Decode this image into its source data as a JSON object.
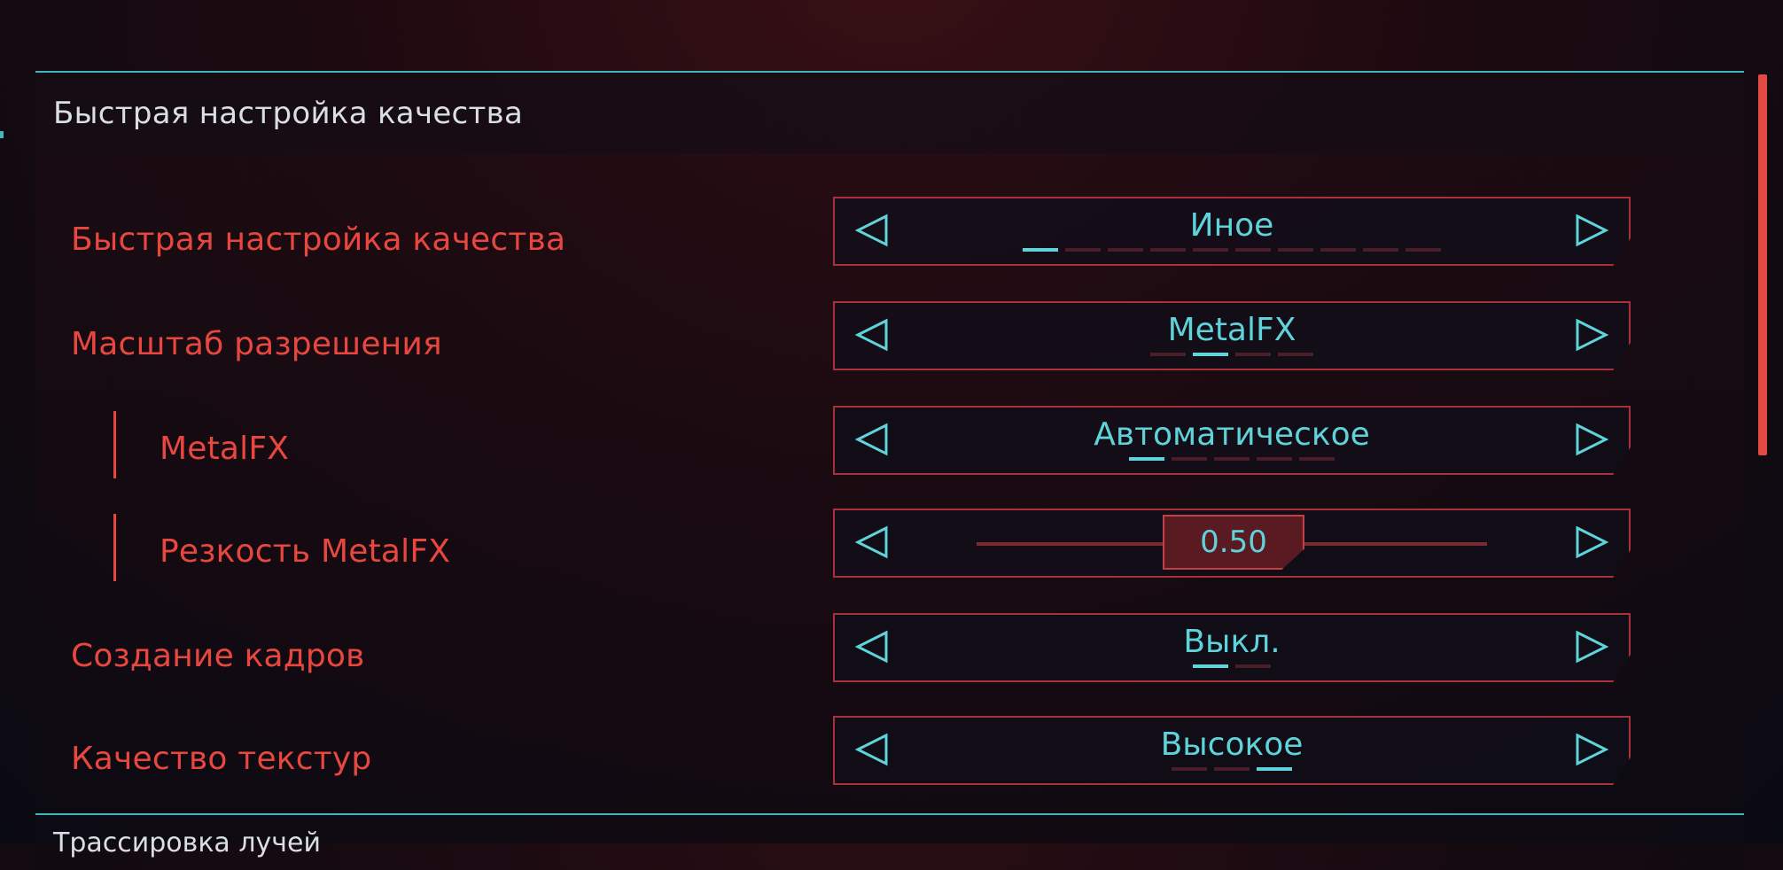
{
  "section": {
    "title": "Быстрая настройка качества",
    "next_title": "Трассировка лучей"
  },
  "colors": {
    "label": "#e8473f",
    "value": "#5fd3da",
    "border": "#a8313b",
    "accent_line": "#3fb7bd"
  },
  "settings": [
    {
      "label": "Быстрая настройка качества",
      "value": "Иное",
      "option_count": 10,
      "selected_index": 0
    },
    {
      "label": "Масштаб разрешения",
      "value": "MetalFX",
      "option_count": 4,
      "selected_index": 1
    },
    {
      "label": "MetalFX",
      "value": "Автоматическое",
      "option_count": 5,
      "selected_index": 0,
      "sub": true
    },
    {
      "label": "Резкость MetalFX",
      "value": "0.50",
      "type": "slider",
      "fraction": 0.5,
      "sub": true
    },
    {
      "label": "Создание кадров",
      "value": "Выкл.",
      "option_count": 2,
      "selected_index": 0
    },
    {
      "label": "Качество текстур",
      "value": "Высокое",
      "option_count": 3,
      "selected_index": 2
    }
  ],
  "icons": {
    "prev": "triangle-left-icon",
    "next": "triangle-right-icon"
  }
}
